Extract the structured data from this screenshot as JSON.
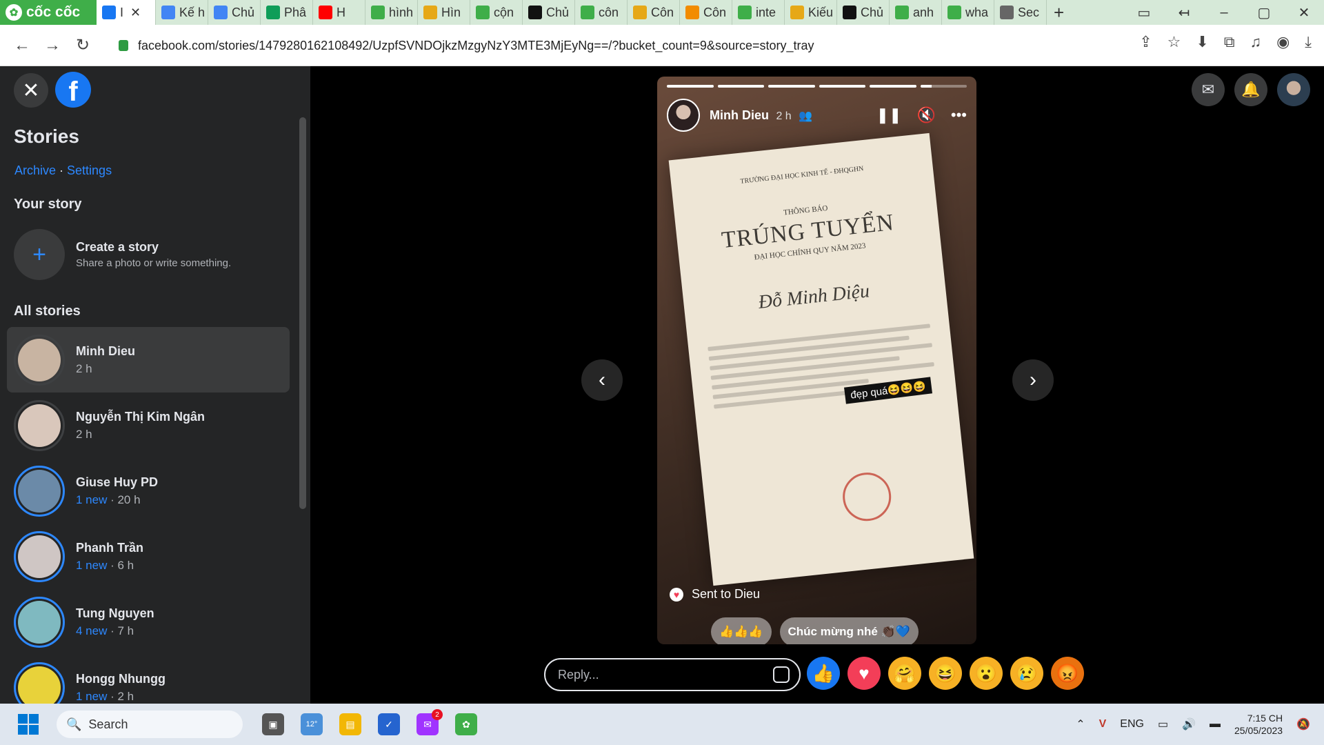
{
  "browser": {
    "brand": "cốc cốc",
    "tabs": [
      {
        "label": "I",
        "active": true
      },
      {
        "label": "Kế h"
      },
      {
        "label": "Chủ"
      },
      {
        "label": "Phâ"
      },
      {
        "label": "H"
      },
      {
        "label": "hình"
      },
      {
        "label": "Hìn"
      },
      {
        "label": "cộn"
      },
      {
        "label": "Chủ"
      },
      {
        "label": "côn"
      },
      {
        "label": "Côn"
      },
      {
        "label": "Côn"
      },
      {
        "label": "inte"
      },
      {
        "label": "Kiếu"
      },
      {
        "label": "Chủ"
      },
      {
        "label": "anh"
      },
      {
        "label": "wha"
      },
      {
        "label": "Sec"
      }
    ],
    "url": "facebook.com/stories/1479280162108492/UzpfSVNDOjkzMzgyNzY3MTE3MjEyNg==/?bucket_count=9&source=story_tray"
  },
  "sidebar": {
    "title": "Stories",
    "archive": "Archive",
    "sep": " · ",
    "settings": "Settings",
    "your_story": "Your story",
    "create_title": "Create a story",
    "create_sub": "Share a photo or write something.",
    "all_stories": "All stories",
    "stories": [
      {
        "name": "Minh Dieu",
        "new": "",
        "time": "2 h",
        "color": "#c8b4a2"
      },
      {
        "name": "Nguyễn Thị Kim Ngân",
        "new": "",
        "time": "2 h",
        "color": "#d9c7bb"
      },
      {
        "name": "Giuse Huy PD",
        "new": "1 new",
        "time": " · 20 h",
        "color": "#6b8aa8"
      },
      {
        "name": "Phanh Trần",
        "new": "1 new",
        "time": " · 6 h",
        "color": "#cfc6c4"
      },
      {
        "name": "Tung Nguyen",
        "new": "4 new",
        "time": " · 7 h",
        "color": "#7fb9c0"
      },
      {
        "name": "Hongg Nhungg",
        "new": "1 new",
        "time": " · 2 h",
        "color": "#e8d23a"
      }
    ]
  },
  "viewer": {
    "author": "Minh Dieu",
    "time": "2 h",
    "progress": [
      1,
      1,
      1,
      1,
      1,
      0.25
    ],
    "paper": {
      "header": "TRƯỜNG ĐẠI HỌC KINH TẾ - ĐHQGHN",
      "notice": "THÔNG BÁO",
      "title": "TRÚNG TUYỂN",
      "subtitle": "ĐẠI HỌC CHÍNH QUY NĂM 2023",
      "name": "Đỗ Minh Diệu"
    },
    "sticker": "đẹp quá😆😆😆",
    "sent": "Sent to Dieu",
    "chip1": "👍👍👍",
    "chip2": "Chúc mừng nhé 👏🏿💙",
    "reply_placeholder": "Reply...",
    "reactions": [
      {
        "icon": "like-icon",
        "glyph": "👍",
        "color": "#1877f2"
      },
      {
        "icon": "love-icon",
        "glyph": "♥",
        "color": "#f33e58"
      },
      {
        "icon": "care-icon",
        "glyph": "🤗",
        "color": "#f7b125"
      },
      {
        "icon": "haha-icon",
        "glyph": "😆",
        "color": "#f7b125"
      },
      {
        "icon": "wow-icon",
        "glyph": "😮",
        "color": "#f7b125"
      },
      {
        "icon": "sad-icon",
        "glyph": "😢",
        "color": "#f7b125"
      },
      {
        "icon": "angry-icon",
        "glyph": "😡",
        "color": "#e9710f"
      }
    ]
  },
  "taskbar": {
    "search": "Search",
    "weather": "12°",
    "messenger_badge": "2",
    "lang": "ENG",
    "time": "7:15 CH",
    "date": "25/05/2023"
  }
}
